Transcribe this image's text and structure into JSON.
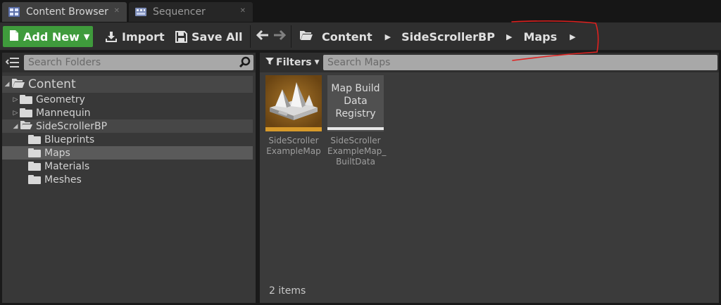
{
  "tabs": [
    {
      "label": "Content Browser",
      "active": true,
      "icon": "content-browser-icon"
    },
    {
      "label": "Sequencer",
      "active": false,
      "icon": "sequencer-icon"
    }
  ],
  "toolbar": {
    "add_new_label": "Add New",
    "import_label": "Import",
    "save_all_label": "Save All"
  },
  "breadcrumb": [
    "Content",
    "SideScrollerBP",
    "Maps"
  ],
  "folder_search": {
    "placeholder": "Search Folders"
  },
  "tree": [
    {
      "label": "Content",
      "level": 0,
      "expanded": true
    },
    {
      "label": "Geometry",
      "level": 1,
      "expanded": false
    },
    {
      "label": "Mannequin",
      "level": 1,
      "expanded": false
    },
    {
      "label": "SideScrollerBP",
      "level": 1,
      "expanded": true
    },
    {
      "label": "Blueprints",
      "level": 2
    },
    {
      "label": "Maps",
      "level": 2,
      "selected": true
    },
    {
      "label": "Materials",
      "level": 2
    },
    {
      "label": "Meshes",
      "level": 2
    }
  ],
  "filters": {
    "label": "Filters",
    "search_placeholder": "Search Maps"
  },
  "assets": [
    {
      "line1": "SideScroller",
      "line2": "ExampleMap",
      "line3": "",
      "type_color": "#d79a2a",
      "icon": "level-map-icon"
    },
    {
      "thumb_line1": "Map Build",
      "thumb_line2": "Data",
      "thumb_line3": "Registry",
      "line1": "SideScroller",
      "line2": "ExampleMap_",
      "line3": "BuiltData",
      "type_color": "#e8e8e8"
    }
  ],
  "status": {
    "items_count": "2 items"
  },
  "colors": {
    "add_new": "#3f9b3c",
    "selected_row": "#5a5a5a",
    "annotation": "#e0211f"
  }
}
